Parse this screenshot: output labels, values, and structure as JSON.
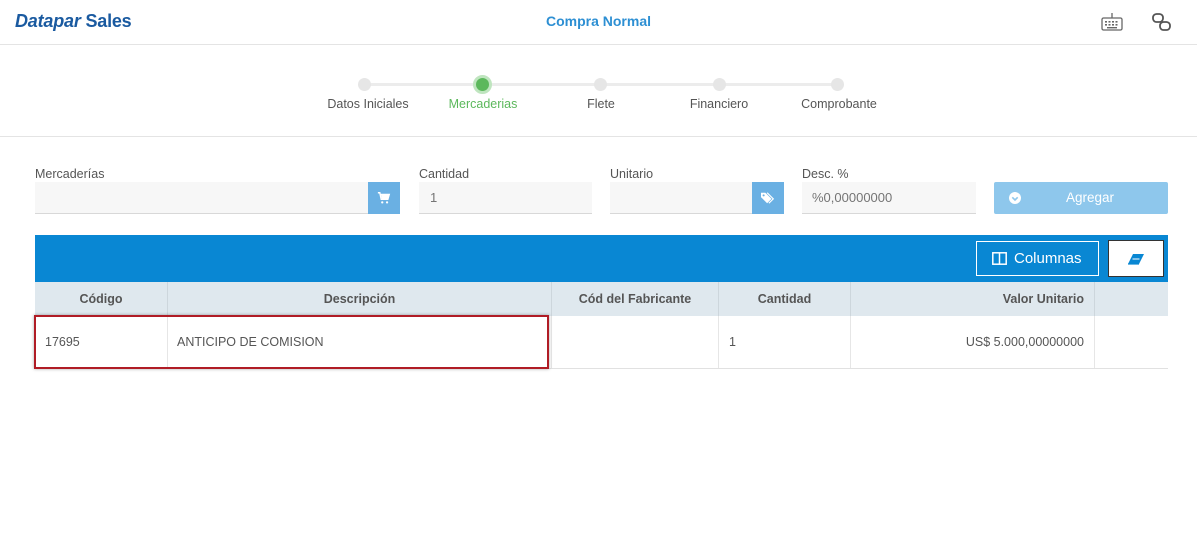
{
  "header": {
    "logo_brand": "Datapar",
    "logo_product": "Sales",
    "title": "Compra Normal",
    "icons": [
      "keyboard-icon",
      "link-icon"
    ]
  },
  "stepper": {
    "steps": [
      {
        "label": "Datos Iniciales"
      },
      {
        "label": "Mercaderias"
      },
      {
        "label": "Flete"
      },
      {
        "label": "Financiero"
      },
      {
        "label": "Comprobante"
      }
    ],
    "active_step": "Mercaderias",
    "active_color": "#5cb85c"
  },
  "form": {
    "mercaderias": {
      "label": "Mercaderías",
      "value": "",
      "icon": "cart-icon"
    },
    "cantidad": {
      "label": "Cantidad",
      "placeholder": "1"
    },
    "unitario": {
      "label": "Unitario",
      "value": "",
      "icon": "tag-icon"
    },
    "descuento": {
      "label": "Desc. %",
      "placeholder": "%0,00000000"
    },
    "agregar_label": "Agregar"
  },
  "toolbar": {
    "columnas_label": "Columnas",
    "color": "#0987d3"
  },
  "table": {
    "headers": [
      "Código",
      "Descripción",
      "Cód del Fabricante",
      "Cantidad",
      "Valor Unitario",
      ""
    ],
    "rows": [
      {
        "codigo": "17695",
        "descripcion": "ANTICIPO DE COMISION",
        "cod_fabricante": "",
        "cantidad": "1",
        "valor_unitario": "US$ 5.000,00000000"
      }
    ]
  }
}
